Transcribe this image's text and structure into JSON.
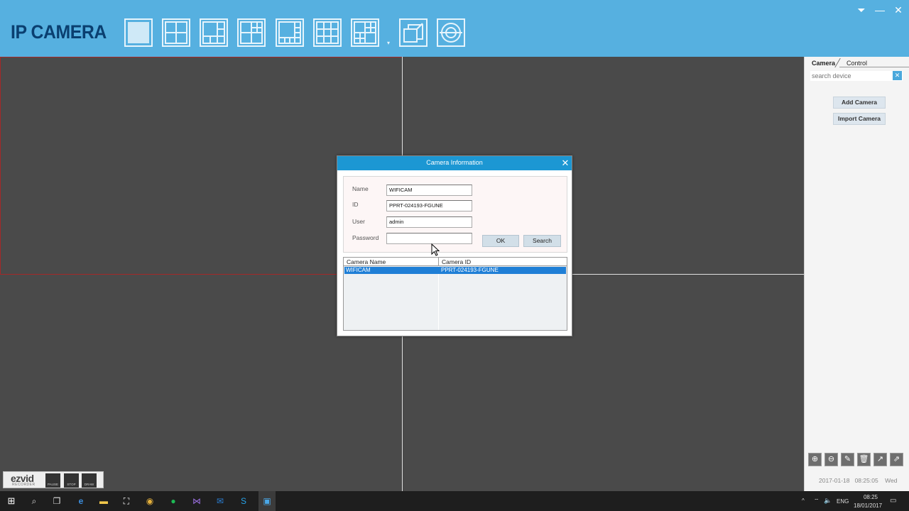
{
  "app": {
    "title": "IP CAMERA"
  },
  "layout_buttons": [
    {
      "name": "layout-1-icon"
    },
    {
      "name": "layout-4-icon"
    },
    {
      "name": "layout-6-icon"
    },
    {
      "name": "layout-8-icon"
    },
    {
      "name": "layout-9-icon"
    },
    {
      "name": "layout-9b-icon"
    },
    {
      "name": "layout-13-icon"
    },
    {
      "name": "fullscreen-icon"
    },
    {
      "name": "cycle-icon"
    }
  ],
  "window_controls": {
    "minimize_tray": "⏷",
    "minimize": "—",
    "close": "✕"
  },
  "right_panel": {
    "tabs": [
      "Camera",
      "Control"
    ],
    "search_placeholder": "search device",
    "add_camera": "Add Camera",
    "import_camera": "Import Camera",
    "tools": [
      "zoom-in-icon",
      "zoom-out-icon",
      "edit-icon",
      "delete-icon",
      "export-icon",
      "share-icon"
    ],
    "clock": {
      "date": "2017-01-18",
      "time": "08:25:05",
      "day": "Wed"
    }
  },
  "dialog": {
    "title": "Camera Information",
    "fields": {
      "name_label": "Name",
      "name_value": "WIFICAM",
      "id_label": "ID",
      "id_value": "PPRT-024193-FGUNE",
      "user_label": "User",
      "user_value": "admin",
      "password_label": "Password",
      "password_value": ""
    },
    "ok": "OK",
    "search": "Search",
    "list": {
      "headers": [
        "Camera Name",
        "Camera ID"
      ],
      "rows": [
        {
          "name": "WIFICAM",
          "id": "PPRT-024193-FGUNE",
          "selected": true
        }
      ]
    }
  },
  "recorder": {
    "logo": "ezvid",
    "sub": "RECORDER",
    "buttons": [
      "PAUSE",
      "STOP",
      "DRAW"
    ]
  },
  "taskbar": {
    "lang": "ENG",
    "time": "08:25",
    "date": "18/01/2017"
  }
}
